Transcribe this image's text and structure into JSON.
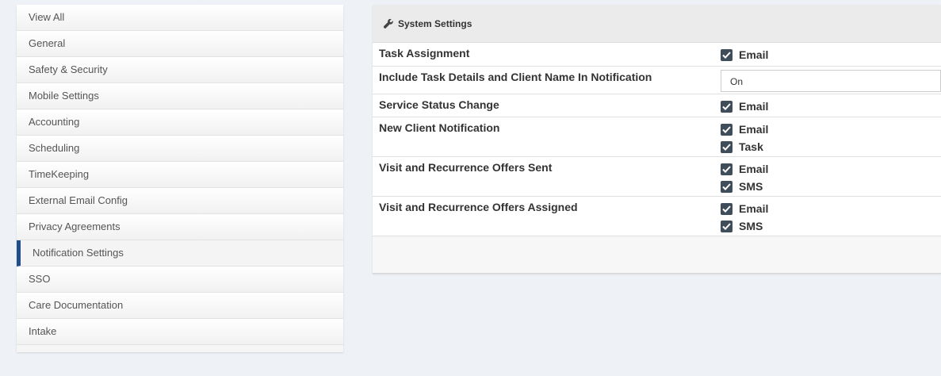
{
  "sidebar": {
    "items": [
      {
        "label": "View All"
      },
      {
        "label": "General"
      },
      {
        "label": "Safety & Security"
      },
      {
        "label": "Mobile Settings"
      },
      {
        "label": "Accounting"
      },
      {
        "label": "Scheduling"
      },
      {
        "label": "TimeKeeping"
      },
      {
        "label": "External Email Config"
      },
      {
        "label": "Privacy Agreements"
      },
      {
        "label": "Notification Settings",
        "active": true
      },
      {
        "label": "SSO"
      },
      {
        "label": "Care Documentation"
      },
      {
        "label": "Intake"
      }
    ]
  },
  "panel": {
    "title": "System Settings",
    "title_icon": "wrench-icon",
    "rows": [
      {
        "label": "Task Assignment",
        "options": [
          {
            "label": "Email",
            "checked": true
          }
        ]
      },
      {
        "label": "Include Task Details and Client Name In Notification",
        "select_value": "On"
      },
      {
        "label": "Service Status Change",
        "options": [
          {
            "label": "Email",
            "checked": true
          }
        ]
      },
      {
        "label": "New Client Notification",
        "options": [
          {
            "label": "Email",
            "checked": true
          },
          {
            "label": "Task",
            "checked": true
          }
        ]
      },
      {
        "label": "Visit and Recurrence Offers Sent",
        "options": [
          {
            "label": "Email",
            "checked": true
          },
          {
            "label": "SMS",
            "checked": true
          }
        ]
      },
      {
        "label": "Visit and Recurrence Offers Assigned",
        "options": [
          {
            "label": "Email",
            "checked": true
          },
          {
            "label": "SMS",
            "checked": true
          }
        ]
      }
    ]
  },
  "colors": {
    "active_accent": "#1f4e8c",
    "checkbox": "#3f4d5a",
    "page_background": "#eef1f5"
  }
}
